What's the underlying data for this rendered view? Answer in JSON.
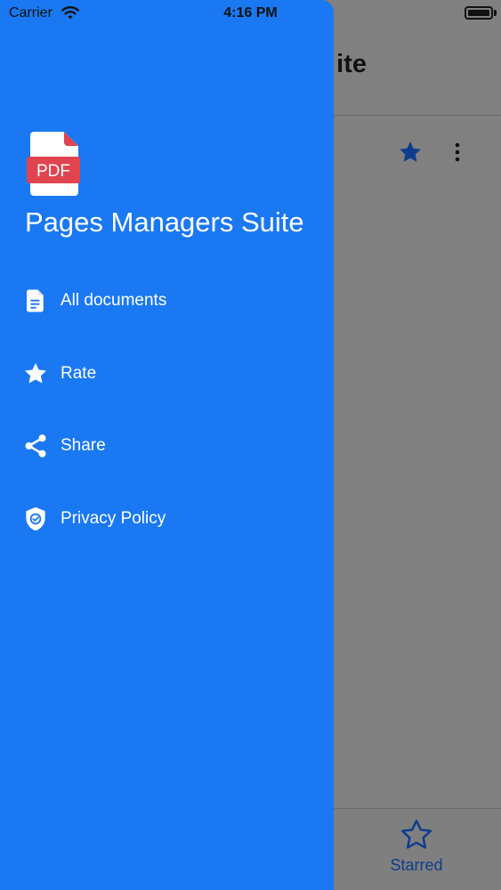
{
  "status_bar": {
    "carrier": "Carrier",
    "time": "4:16 PM"
  },
  "background": {
    "title_fragment": "ite",
    "tab": {
      "label": "Starred",
      "icon": "star-outline-icon"
    },
    "row_actions": [
      "star-icon",
      "more-vertical-icon"
    ]
  },
  "drawer": {
    "app_name": "Pages Managers Suite",
    "logo_text": "PDF",
    "items": [
      {
        "label": "All documents",
        "icon": "document-icon"
      },
      {
        "label": "Rate",
        "icon": "star-icon"
      },
      {
        "label": "Share",
        "icon": "share-icon"
      },
      {
        "label": "Privacy Policy",
        "icon": "shield-check-icon"
      }
    ]
  },
  "colors": {
    "drawer_background": "#1a78f2",
    "dim_overlay": "#808080",
    "logo_red": "#e0454f",
    "starred_blue": "#0e3d8c"
  }
}
